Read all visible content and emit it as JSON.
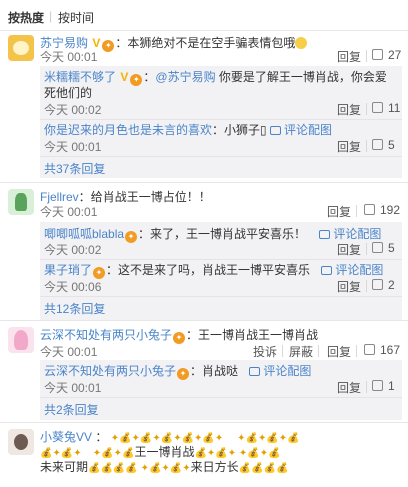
{
  "sort": {
    "hot": "按热度",
    "sep": "|",
    "time": "按时间"
  },
  "comments": [
    {
      "user": "苏宁易购",
      "text": "本狮绝对不是在空手骗表情包哦",
      "time": "今天 00:01",
      "reply": "回复",
      "likes": "27"
    },
    {
      "user": "Fjellrev",
      "text": "给肖战王一博占位！！",
      "time": "今天 00:01",
      "reply": "回复",
      "likes": "192"
    },
    {
      "user": "云深不知处有两只小兔子",
      "text": "王一博肖战王一博肖战",
      "time": "今天 00:01",
      "report": "投诉",
      "block": "屏蔽",
      "reply": "回复",
      "likes": "167"
    },
    {
      "user": "小葵兔VV",
      "line1": "：✦̴̵̶̷̸̡̢̧̨̛̖̗̘̙̜̝̞̟̠̣̤̥̦̩̪̫̬̭̮̯̰̱̲̳̹̺̻̼͇͈͉͍͎̀́̂̃̄̅̆̇̈̉̊̋̌̍̎̏̐̑̒̓̔̽̾̿̀́͂̓̈́͆͊͋͌̕̚ͅ͏͓͔͕͖͙͚͐͑͒͗͛ͣͤͥͦͧͨͩͪͫͬͭͮͯ͘͜͟͢͝͞͠͡",
      "line2": "王一博肖战",
      "line3": "未来可期",
      "line4": "来日方长"
    }
  ],
  "replies": [
    {
      "user": "米糯糯不够了",
      "mention": "@苏宁易购",
      "text": "你要是了解王一博肖战，你会爱死他们的",
      "line1": "你要是了解王一博肖战，你会爱",
      "line2": "死他们的",
      "time": "今天 00:02",
      "reply": "回复",
      "likes": "11"
    },
    {
      "user": "你是迟来的月色也是未言的喜欢",
      "text": "小狮子",
      "action": "评论配图",
      "time": "今天 00:01",
      "reply": "回复",
      "likes": "5"
    },
    {
      "user": "唧唧呱呱blabla",
      "text": "来了，王一博肖战平安喜乐！",
      "action": "评论配图",
      "time": "今天 00:02",
      "reply": "回复",
      "likes": "5"
    },
    {
      "user": "果子琑了",
      "text": "这不是来了吗，肖战王一博平安喜乐",
      "action": "评论配图",
      "time": "今天 00:06",
      "reply": "回复",
      "likes": "2"
    },
    {
      "user": "云深不知处有两只小兔子",
      "text": "肖战哒",
      "action": "评论配图",
      "time": "今天 00:01",
      "reply": "回复",
      "likes": "1"
    }
  ],
  "more": [
    "共37条回复",
    "共12条回复",
    "共2条回复"
  ],
  "icons": [
    "vip-v-icon",
    "member-badge-icon",
    "thumb-up-icon",
    "comment-image-icon",
    "money-bag-icon",
    "sparkle-icon"
  ]
}
